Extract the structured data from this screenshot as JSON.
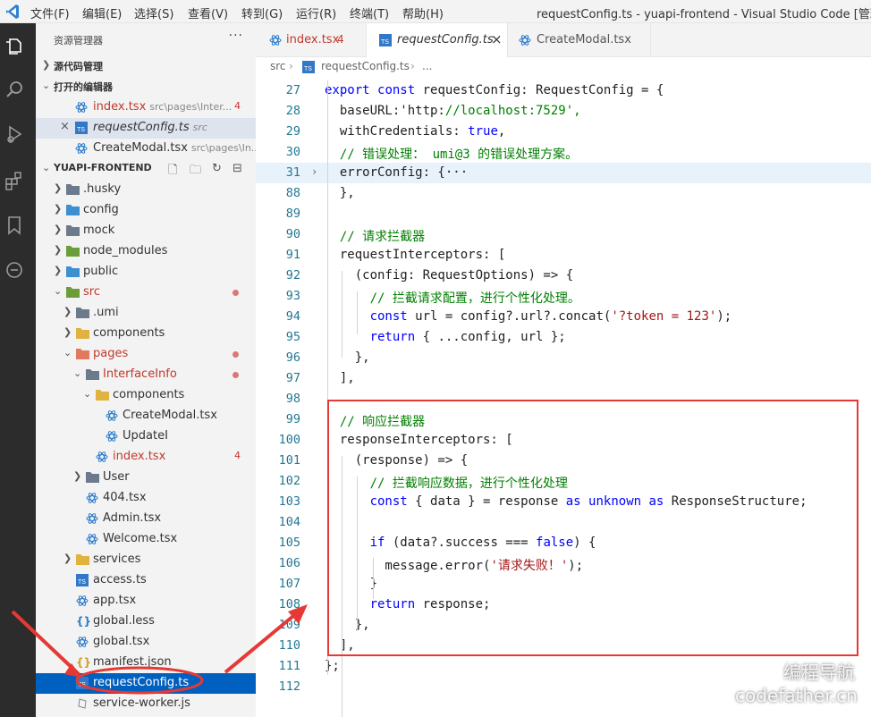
{
  "window": {
    "title": "requestConfig.ts - yuapi-frontend - Visual Studio Code [管理员]",
    "menu": [
      "文件(F)",
      "编辑(E)",
      "选择(S)",
      "查看(V)",
      "转到(G)",
      "运行(R)",
      "终端(T)",
      "帮助(H)"
    ]
  },
  "sidebar": {
    "title": "资源管理器",
    "more": "···",
    "source_control": "源代码管理",
    "open_editors": "打开的编辑器",
    "open_files": [
      {
        "name": "index.tsx",
        "path": "src\\pages\\Inter...",
        "count": "4"
      },
      {
        "name": "requestConfig.ts",
        "path": "src",
        "close": "×"
      },
      {
        "name": "CreateModal.tsx",
        "path": "src\\pages\\In..."
      }
    ],
    "project": "YUAPI-FRONTEND",
    "tree": [
      {
        "name": ".husky"
      },
      {
        "name": "config"
      },
      {
        "name": "mock"
      },
      {
        "name": "node_modules"
      },
      {
        "name": "public"
      },
      {
        "name": "src"
      },
      {
        "name": ".umi"
      },
      {
        "name": "components"
      },
      {
        "name": "pages"
      },
      {
        "name": "InterfaceInfo"
      },
      {
        "name": "components"
      },
      {
        "name": "CreateModal.tsx"
      },
      {
        "name": "UpdateI"
      },
      {
        "name": "index.tsx",
        "count": "4"
      },
      {
        "name": "User"
      },
      {
        "name": "404.tsx"
      },
      {
        "name": "Admin.tsx"
      },
      {
        "name": "Welcome.tsx"
      },
      {
        "name": "services"
      },
      {
        "name": "access.ts"
      },
      {
        "name": "app.tsx"
      },
      {
        "name": "global.less"
      },
      {
        "name": "global.tsx"
      },
      {
        "name": "manifest.json"
      },
      {
        "name": "requestConfig.ts"
      },
      {
        "name": "service-worker.js"
      }
    ]
  },
  "tabs": [
    {
      "label": "index.tsx",
      "count": "4"
    },
    {
      "label": "requestConfig.ts",
      "close": "×"
    },
    {
      "label": "CreateModal.tsx"
    }
  ],
  "breadcrumb": {
    "folder": "src",
    "file": "requestConfig.ts",
    "more": "..."
  },
  "code": {
    "lines": [
      {
        "n": "27",
        "t": "export const requestConfig: RequestConfig = {"
      },
      {
        "n": "28",
        "t": "  baseURL:'http://localhost:7529',"
      },
      {
        "n": "29",
        "t": "  withCredentials: true,"
      },
      {
        "n": "30",
        "t": "  // 错误处理： umi@3 的错误处理方案。"
      },
      {
        "n": "31",
        "t": "  errorConfig: {···"
      },
      {
        "n": "88",
        "t": "  },"
      },
      {
        "n": "89",
        "t": ""
      },
      {
        "n": "90",
        "t": "  // 请求拦截器"
      },
      {
        "n": "91",
        "t": "  requestInterceptors: ["
      },
      {
        "n": "92",
        "t": "    (config: RequestOptions) => {"
      },
      {
        "n": "93",
        "t": "      // 拦截请求配置，进行个性化处理。"
      },
      {
        "n": "94",
        "t": "      const url = config?.url?.concat('?token = 123');"
      },
      {
        "n": "95",
        "t": "      return { ...config, url };"
      },
      {
        "n": "96",
        "t": "    },"
      },
      {
        "n": "97",
        "t": "  ],"
      },
      {
        "n": "98",
        "t": ""
      },
      {
        "n": "99",
        "t": "  // 响应拦截器"
      },
      {
        "n": "100",
        "t": "  responseInterceptors: ["
      },
      {
        "n": "101",
        "t": "    (response) => {"
      },
      {
        "n": "102",
        "t": "      // 拦截响应数据，进行个性化处理"
      },
      {
        "n": "103",
        "t": "      const { data } = response as unknown as ResponseStructure;"
      },
      {
        "n": "104",
        "t": ""
      },
      {
        "n": "105",
        "t": "      if (data?.success === false) {"
      },
      {
        "n": "106",
        "t": "        message.error('请求失败！');"
      },
      {
        "n": "107",
        "t": "      }"
      },
      {
        "n": "108",
        "t": "      return response;"
      },
      {
        "n": "109",
        "t": "    },"
      },
      {
        "n": "110",
        "t": "  ],"
      },
      {
        "n": "111",
        "t": "};"
      },
      {
        "n": "112",
        "t": ""
      }
    ]
  },
  "watermark": {
    "line1": "编程导航",
    "line2": "codefather.cn"
  },
  "colors": {
    "accent": "#0060c0",
    "highlight_box": "#e53935",
    "keyword": "#0000ff",
    "string": "#a31515",
    "comment": "#008000"
  }
}
